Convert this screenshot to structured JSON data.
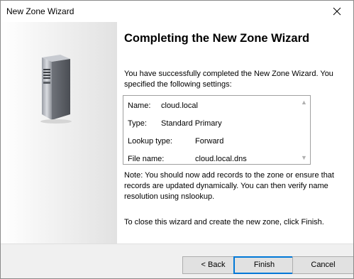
{
  "window": {
    "title": "New Zone Wizard",
    "close_icon": "close-icon"
  },
  "left_panel": {
    "art_icon": "server-icon"
  },
  "main": {
    "heading": "Completing the New Zone Wizard",
    "intro": "You have successfully completed the New Zone Wizard. You specified the following settings:",
    "settings": [
      {
        "label": "Name:",
        "value": "cloud.local"
      },
      {
        "label": "Type:",
        "value": "Standard Primary"
      },
      {
        "label": "Lookup type:",
        "value": "Forward"
      },
      {
        "label": "File name:",
        "value": "cloud.local.dns"
      }
    ],
    "note": "Note: You should now add records to the zone or ensure that records are updated dynamically. You can then verify name resolution using nslookup.",
    "closing": "To close this wizard and create the new zone, click Finish."
  },
  "buttons": {
    "back": "< Back",
    "finish": "Finish",
    "cancel": "Cancel"
  },
  "colors": {
    "accent": "#0078d7",
    "footer_bg": "#f0f0f0"
  }
}
